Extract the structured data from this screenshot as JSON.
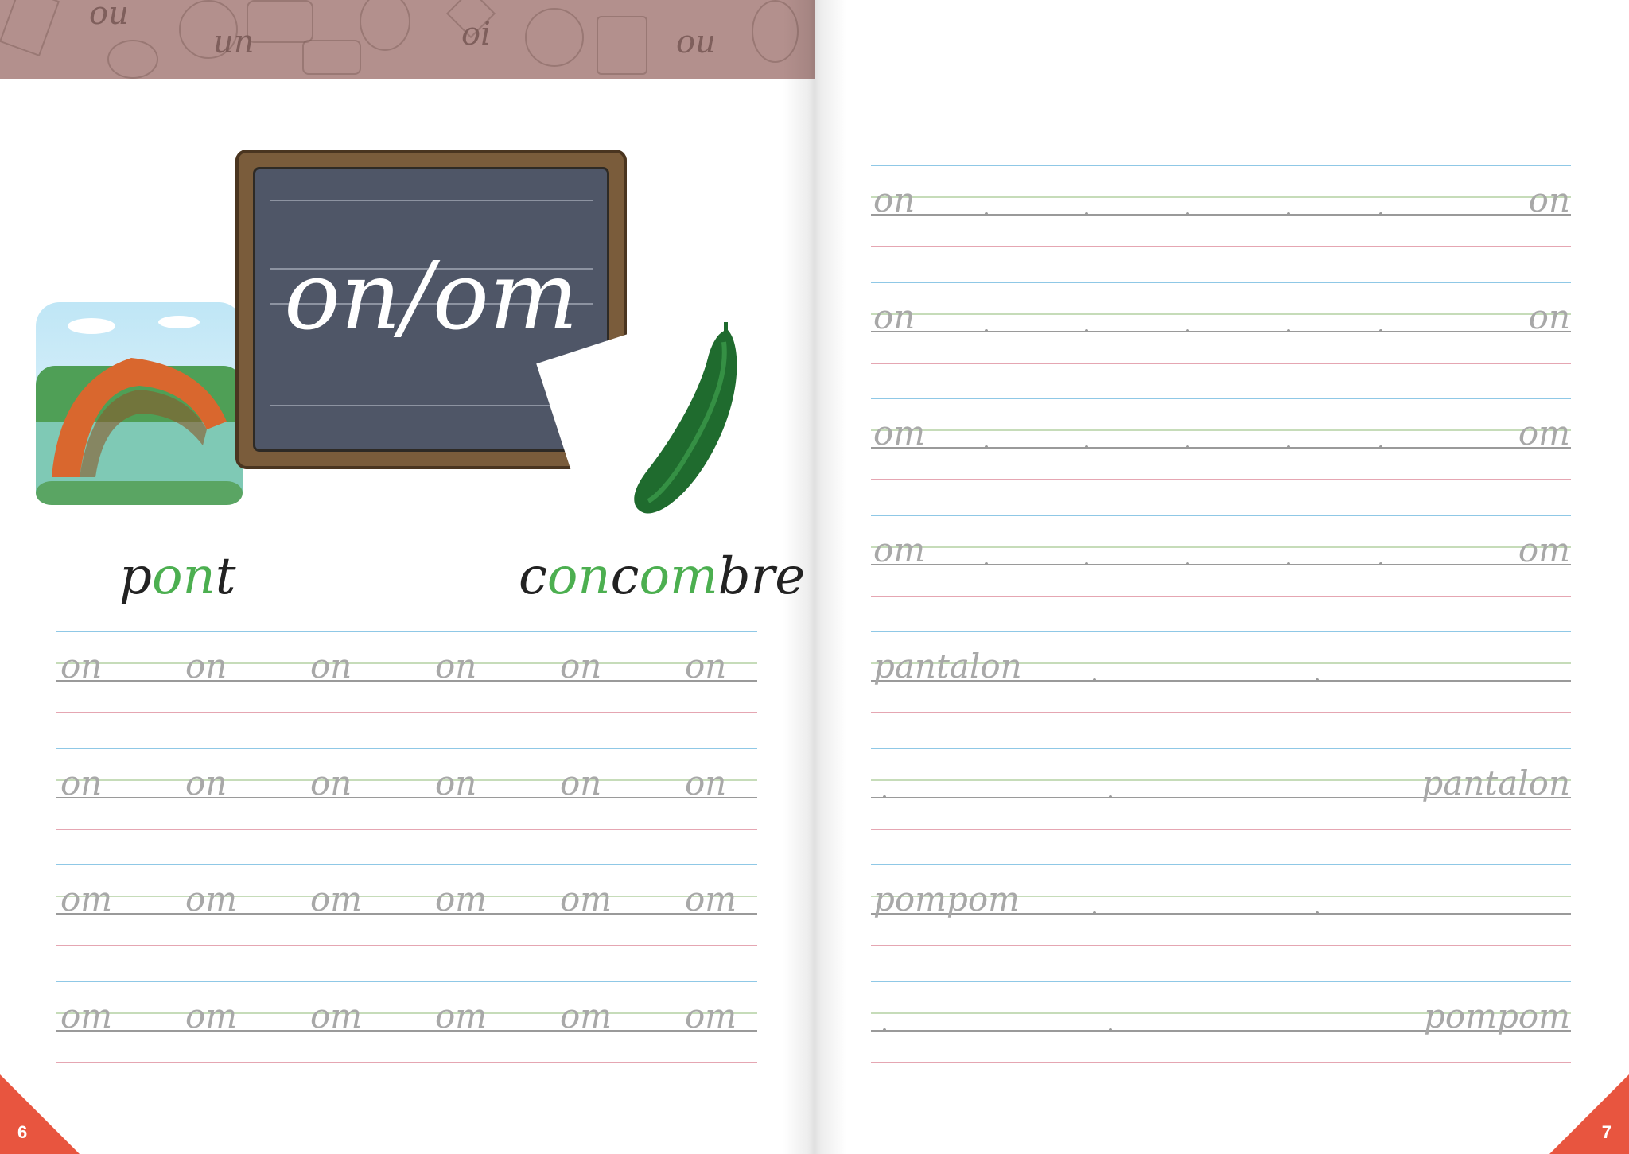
{
  "banner": {
    "words": [
      "ou",
      "un",
      "oi",
      "ou"
    ]
  },
  "left_page": {
    "slate_title": "on/om",
    "example_words": {
      "pont": {
        "parts": [
          "p",
          "on",
          "t"
        ]
      },
      "concombre": {
        "parts": [
          "c",
          "on",
          "c",
          "om",
          "bre"
        ]
      }
    },
    "practice_rows": [
      [
        "on",
        "on",
        "on",
        "on",
        "on",
        "on"
      ],
      [
        "on",
        "on",
        "on",
        "on",
        "on",
        "on"
      ],
      [
        "om",
        "om",
        "om",
        "om",
        "om",
        "om"
      ],
      [
        "om",
        "om",
        "om",
        "om",
        "om",
        "om"
      ]
    ],
    "page_number": "6"
  },
  "right_page": {
    "rows": [
      {
        "left": "on",
        "right": "on"
      },
      {
        "left": "on",
        "right": "on"
      },
      {
        "left": "om",
        "right": "om"
      },
      {
        "left": "om",
        "right": "om"
      },
      {
        "left": "pantalon",
        "right": ""
      },
      {
        "left": "",
        "right": "pantalon"
      },
      {
        "left": "pompom",
        "right": ""
      },
      {
        "left": "",
        "right": "pompom"
      }
    ],
    "page_number": "7"
  },
  "colors": {
    "banner": "#b3908d",
    "line_blue": "#8fc8e6",
    "line_green": "#c6dcb9",
    "line_gray": "#9a9a9a",
    "line_pink": "#e5a6b2",
    "highlight_green": "#4caf50",
    "corner": "#e8553f"
  }
}
